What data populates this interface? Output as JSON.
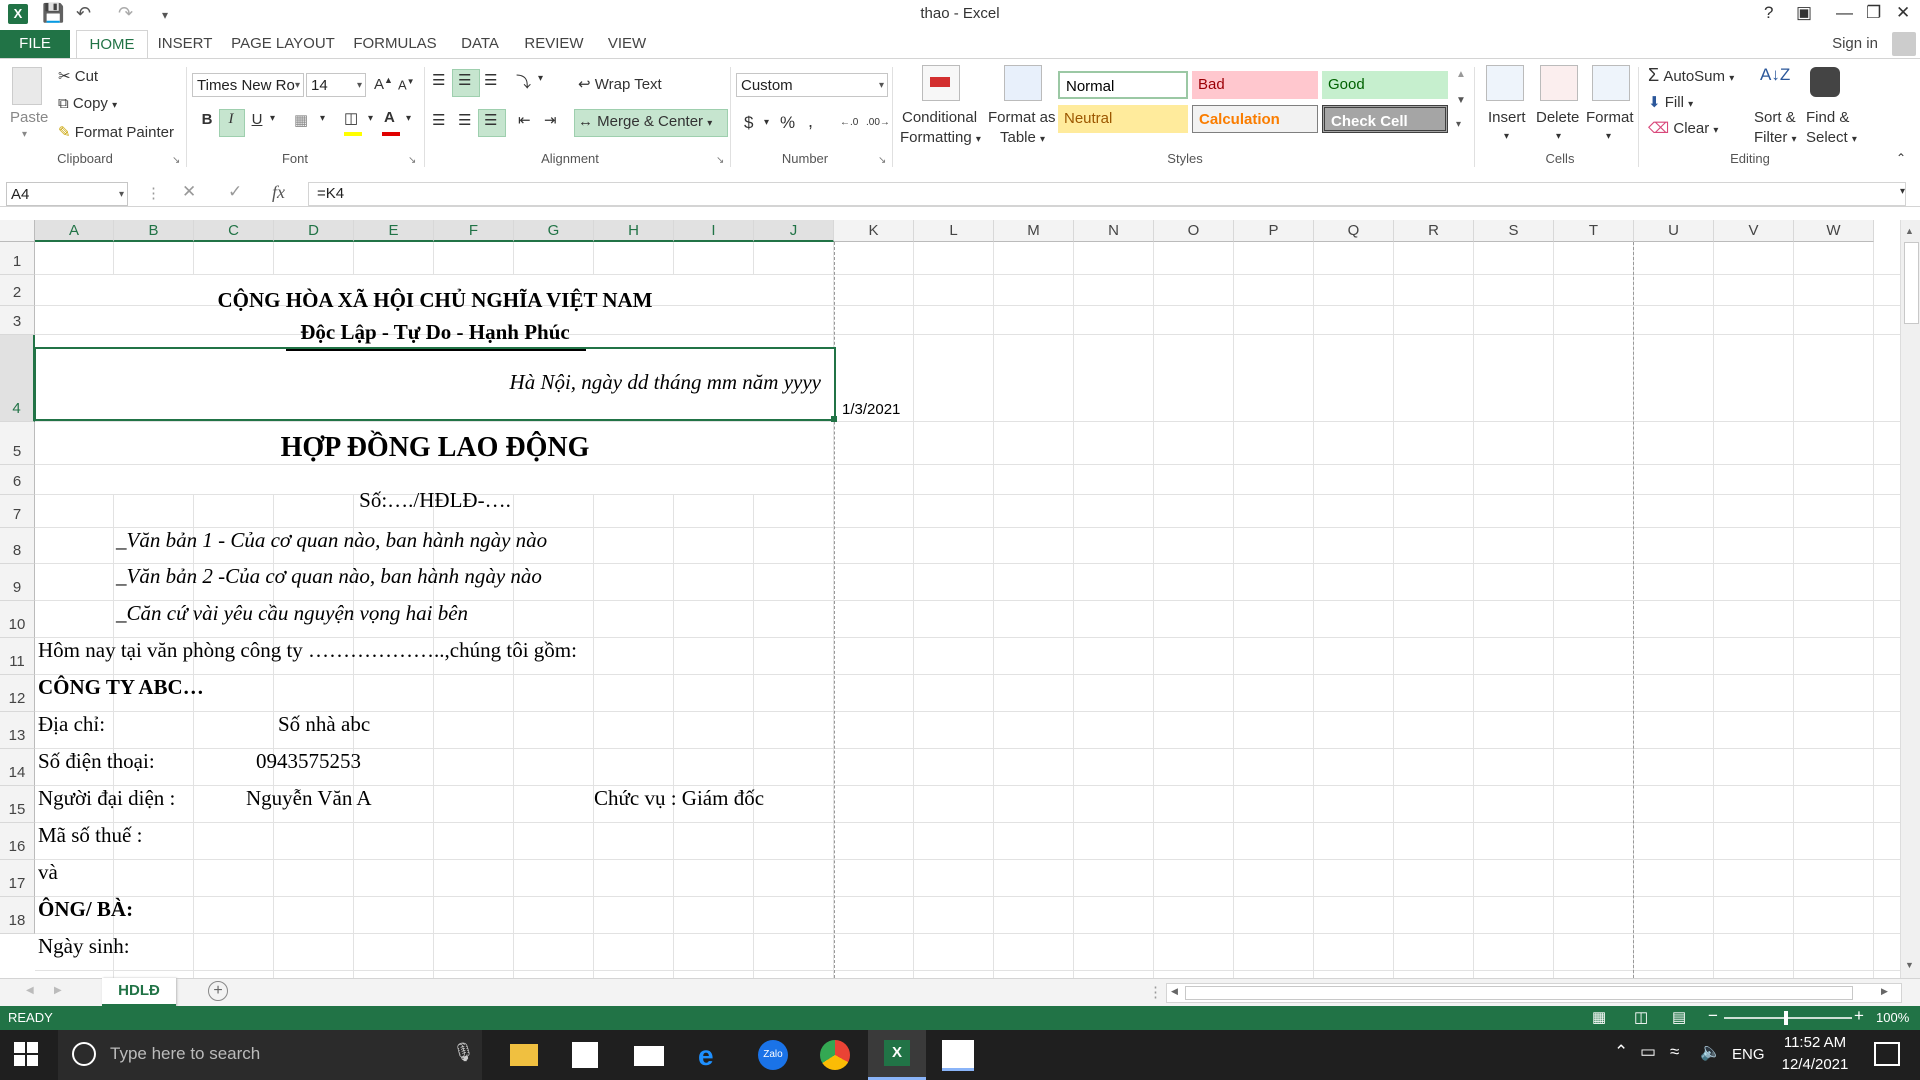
{
  "window": {
    "title": "thao - Excel",
    "help": "?",
    "sign_in": "Sign in"
  },
  "tabs": [
    "FILE",
    "HOME",
    "INSERT",
    "PAGE LAYOUT",
    "FORMULAS",
    "DATA",
    "REVIEW",
    "VIEW"
  ],
  "ribbon": {
    "clipboard": {
      "paste": "Paste",
      "cut": "Cut",
      "copy": "Copy",
      "format_painter": "Format Painter",
      "group": "Clipboard"
    },
    "font": {
      "name": "Times New Ro",
      "size": "14",
      "bold": "B",
      "italic": "I",
      "underline": "U",
      "group": "Font"
    },
    "alignment": {
      "wrap_text": "Wrap Text",
      "merge_center": "Merge & Center",
      "group": "Alignment"
    },
    "number": {
      "format": "Custom",
      "currency": "$",
      "percent": "%",
      "comma": ",",
      "group": "Number"
    },
    "styles": {
      "conditional_1": "Conditional",
      "conditional_2": "Formatting",
      "format_table_1": "Format as",
      "format_table_2": "Table",
      "normal": "Normal",
      "bad": "Bad",
      "good": "Good",
      "neutral": "Neutral",
      "calculation": "Calculation",
      "check_cell": "Check Cell",
      "group": "Styles"
    },
    "cells": {
      "insert": "Insert",
      "delete": "Delete",
      "format": "Format",
      "group": "Cells"
    },
    "editing": {
      "autosum": "AutoSum",
      "fill": "Fill",
      "clear": "Clear",
      "sort_1": "Sort &",
      "sort_2": "Filter",
      "find_1": "Find &",
      "find_2": "Select",
      "group": "Editing"
    }
  },
  "formula_bar": {
    "name_box": "A4",
    "formula": "=K4",
    "fx": "fx"
  },
  "columns": [
    "A",
    "B",
    "C",
    "D",
    "E",
    "F",
    "G",
    "H",
    "I",
    "J",
    "K",
    "L",
    "M",
    "N",
    "O",
    "P",
    "Q",
    "R",
    "S",
    "T",
    "U",
    "V",
    "W"
  ],
  "rows": [
    "1",
    "2",
    "3",
    "4",
    "5",
    "6",
    "7",
    "8",
    "9",
    "10",
    "11",
    "12",
    "13",
    "14",
    "15",
    "16",
    "17",
    "18"
  ],
  "cells": {
    "r2": "CỘNG HÒA XÃ HỘI CHỦ NGHĨA VIỆT NAM",
    "r3": "Độc Lập - Tự Do - Hạnh Phúc",
    "r4": "Hà Nội, ngày dd tháng mm năm yyyy",
    "k4": "1/3/2021",
    "r5": "HỢP ĐỒNG LAO ĐỘNG",
    "r6": "Số:…./HĐLĐ-….",
    "r7": "_Văn bản 1 - Của cơ quan nào, ban hành ngày nào",
    "r8": "_Văn bản 2 -Của cơ quan nào, ban hành ngày nào",
    "r9": "_Căn cứ vài yêu cầu nguyện vọng hai bên",
    "r10": "Hôm nay tại văn phòng công ty ………………..,chúng tôi gồm:",
    "r11": "CÔNG TY ABC…",
    "r12a": "Địa chỉ:",
    "r12d": "Số nhà abc",
    "r13a": "Số điện thoại:",
    "r13d": "0943575253",
    "r14a": "Người đại diện :",
    "r14d": "Nguyễn Văn A",
    "r14h": "Chức vụ : Giám đốc",
    "r15": "Mã số thuế :",
    "r16": "và",
    "r17": "ÔNG/ BÀ:",
    "r18": "Ngày sinh:"
  },
  "sheet_tab": "HDLĐ",
  "status": {
    "ready": "READY",
    "zoom": "100%"
  },
  "taskbar": {
    "search_placeholder": "Type here to search",
    "lang": "ENG",
    "time": "11:52 AM",
    "date": "12/4/2021",
    "zalo": "Zalo"
  },
  "colors": {
    "excel_green": "#217346"
  }
}
